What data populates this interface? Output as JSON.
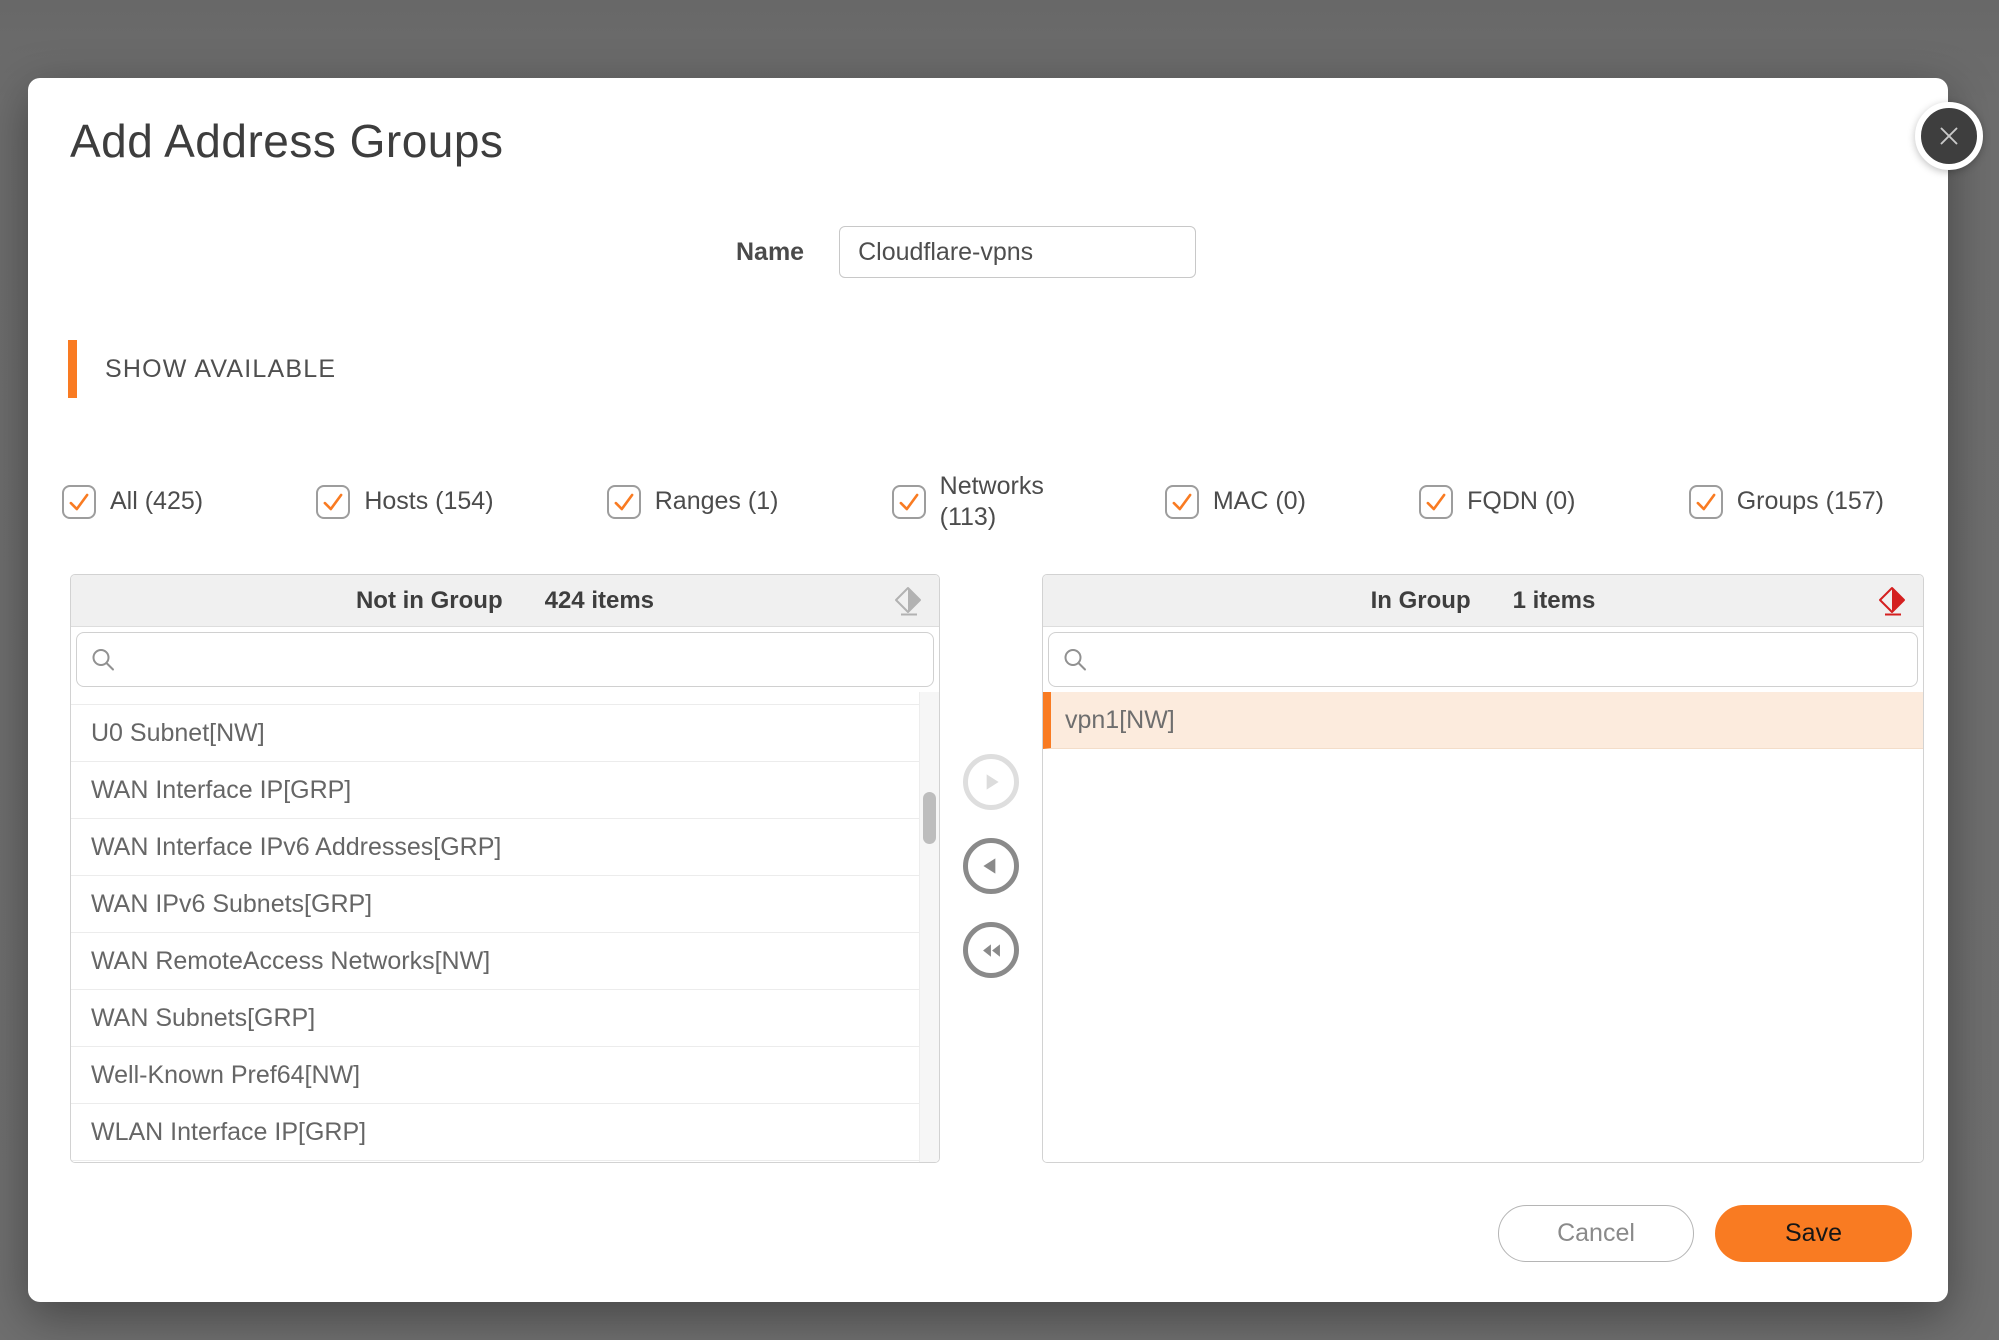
{
  "modal": {
    "title": "Add Address Groups"
  },
  "name_field": {
    "label": "Name",
    "value": "Cloudflare-vpns"
  },
  "section": {
    "header": "SHOW AVAILABLE"
  },
  "filters": [
    {
      "label": "All (425)",
      "checked": true
    },
    {
      "label": "Hosts (154)",
      "checked": true
    },
    {
      "label": "Ranges (1)",
      "checked": true
    },
    {
      "label": "Networks (113)",
      "checked": true,
      "wrap": true
    },
    {
      "label": "MAC (0)",
      "checked": true
    },
    {
      "label": "FQDN (0)",
      "checked": true
    },
    {
      "label": "Groups (157)",
      "checked": true
    }
  ],
  "left_panel": {
    "title": "Not in Group",
    "count": "424 items",
    "search_placeholder": "",
    "items": [
      "U0 Subnet[NW]",
      "WAN Interface IP[GRP]",
      "WAN Interface IPv6 Addresses[GRP]",
      "WAN IPv6 Subnets[GRP]",
      "WAN RemoteAccess Networks[NW]",
      "WAN Subnets[GRP]",
      "Well-Known Pref64[NW]",
      "WLAN Interface IP[GRP]"
    ]
  },
  "right_panel": {
    "title": "In Group",
    "count": "1 items",
    "search_placeholder": "",
    "items": [
      {
        "label": "vpn1[NW]",
        "selected": true
      }
    ]
  },
  "footer": {
    "cancel": "Cancel",
    "save": "Save"
  },
  "colors": {
    "accent": "#F97B22",
    "eraser_red": "#D42020",
    "selected_row_bg": "#FCEBDD"
  }
}
